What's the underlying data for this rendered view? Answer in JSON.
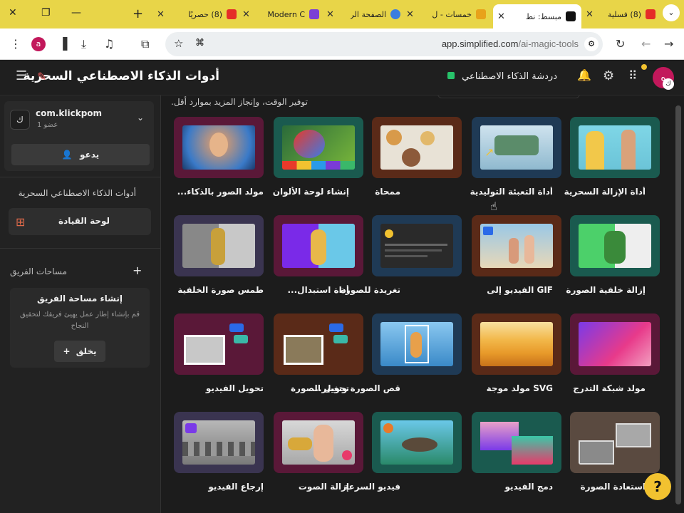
{
  "browser": {
    "tabs": [
      {
        "label": "(8) فسلية",
        "color": "#e52d27"
      },
      {
        "label": "مبسط: نط",
        "color": "#111111"
      },
      {
        "label": "خمسات - ل",
        "color": "#e8a21a"
      },
      {
        "label": "الصفحة الر",
        "color": "#3b7de0"
      },
      {
        "label": "Modern C",
        "color": "#7b3fd6"
      },
      {
        "label": "(8) حصريًا",
        "color": "#e52d27"
      }
    ],
    "url_domain": "app.simplified.com",
    "url_path": "/ai-magic-tools",
    "profile_letter": "a"
  },
  "header": {
    "title": "أدوات الذكاء الاصطناعي السحرية",
    "chat_label": "دردشة الذكاء الاصطناعي",
    "avatar_letter": "ه",
    "avatar_badge": "ك"
  },
  "sidebar": {
    "workspace_name": "com.klickpom",
    "workspace_sub": "عضو 1",
    "workspace_letter": "ك",
    "invite_label": "يدعو",
    "section_title": "أدوات الذكاء الاصطناعي السحرية",
    "dashboard_label": "لوحة القيادة",
    "team_spaces_label": "مساحات الفريق",
    "create_title": "إنشاء مساحة الفريق",
    "create_desc": "قم بإنشاء إطار عمل يهيئ فريقك لتحقيق النجاح",
    "create_button": "يخلق"
  },
  "main": {
    "subtitle": "توفير الوقت، وإنجاز المزيد بموارد أقل.",
    "tools": [
      {
        "label": "أداة الإزالة السحرية",
        "frame": "#1a5a4f"
      },
      {
        "label": "أداة التعبئة التوليدية",
        "frame": "#1f3a55"
      },
      {
        "label": "ممحاة",
        "frame": "#5a2a18"
      },
      {
        "label": "إنشاء لوحة الألوان",
        "frame": "#1a5a4f"
      },
      {
        "label": "مولد الصور بالذكاء...",
        "frame": "#5a1838"
      },
      {
        "label": "إزالة خلفية الصورة",
        "frame": "#1a5a4f"
      },
      {
        "label": "GIF الفيديو إلى",
        "frame": "#5a2a18"
      },
      {
        "label": "تغريدة للصورة",
        "frame": "#1f3a55"
      },
      {
        "label": "أداة استبدال...",
        "frame": "#5a1838"
      },
      {
        "label": "طمس صورة الخلفية",
        "frame": "#3a3450"
      },
      {
        "label": "مولد شبكة التدرج",
        "frame": "#5a1838"
      },
      {
        "label": "SVG مولد موجة",
        "frame": "#5a2a18"
      },
      {
        "label": "قص الصورة وتغيير...",
        "frame": "#1f3a55"
      },
      {
        "label": "تحويل الصورة",
        "frame": "#5a2a18"
      },
      {
        "label": "تحويل الفيديو",
        "frame": "#5a1838"
      },
      {
        "label": "استعادة الصورة",
        "frame": "#5a4a40"
      },
      {
        "label": "دمج الفيديو",
        "frame": "#1a5a4f"
      },
      {
        "label": "فيديو السرعة",
        "frame": "#1a5a4f"
      },
      {
        "label": "إزالة الصوت",
        "frame": "#5a1838"
      },
      {
        "label": "إرجاع الفيديو",
        "frame": "#3a3450"
      }
    ]
  },
  "help_label": "?"
}
